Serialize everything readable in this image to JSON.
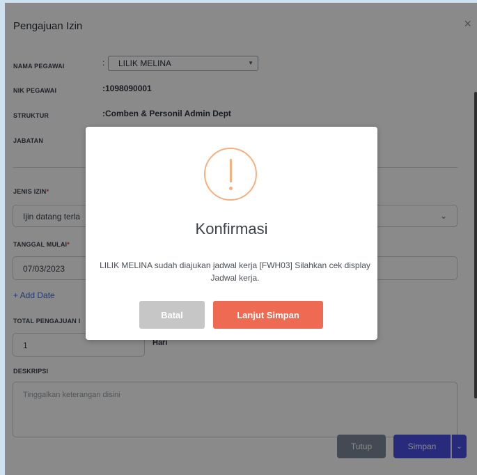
{
  "modal": {
    "title": "Pengajuan Izin",
    "close_icon": "×",
    "labels": {
      "nama_pegawai": "NAMA PEGAWAI",
      "nik_pegawai": "NIK PEGAWAI",
      "struktur": "STRUKTUR",
      "jabatan": "JABATAN",
      "jenis_izin": "JENIS IZIN",
      "tanggal_mulai": "TANGGAL MULAI",
      "total_pengajuan": "TOTAL PENGAJUAN I",
      "deskripsi": "DESKRIPSI",
      "required_mark": "*"
    },
    "values": {
      "nama_pegawai": "LILIK MELINA",
      "nik_pegawai": ":1098090001",
      "struktur": ":Comben & Personil Admin Dept",
      "colon": ":",
      "jenis_izin": "Ijin datang terla",
      "tanggal_mulai": "07/03/2023",
      "total_pengajuan": "1",
      "hari": "Hari",
      "deskripsi_placeholder": "Tinggalkan keterangan disini"
    },
    "add_date": "+ Add Date",
    "buttons": {
      "tutup": "Tutup",
      "simpan": "Simpan",
      "split_icon": "⌄"
    }
  },
  "dialog": {
    "icon": "warning-icon",
    "title": "Konfirmasi",
    "message": "LILIK MELINA sudah diajukan jadwal kerja [FWH03] Silahkan cek display Jadwal kerja.",
    "batal": "Batal",
    "lanjut": "Lanjut Simpan"
  },
  "colors": {
    "primary": "#4b4fe6",
    "danger": "#ee6a52",
    "warning": "#f6b07e",
    "neutral_button": "#c6c6c6"
  }
}
